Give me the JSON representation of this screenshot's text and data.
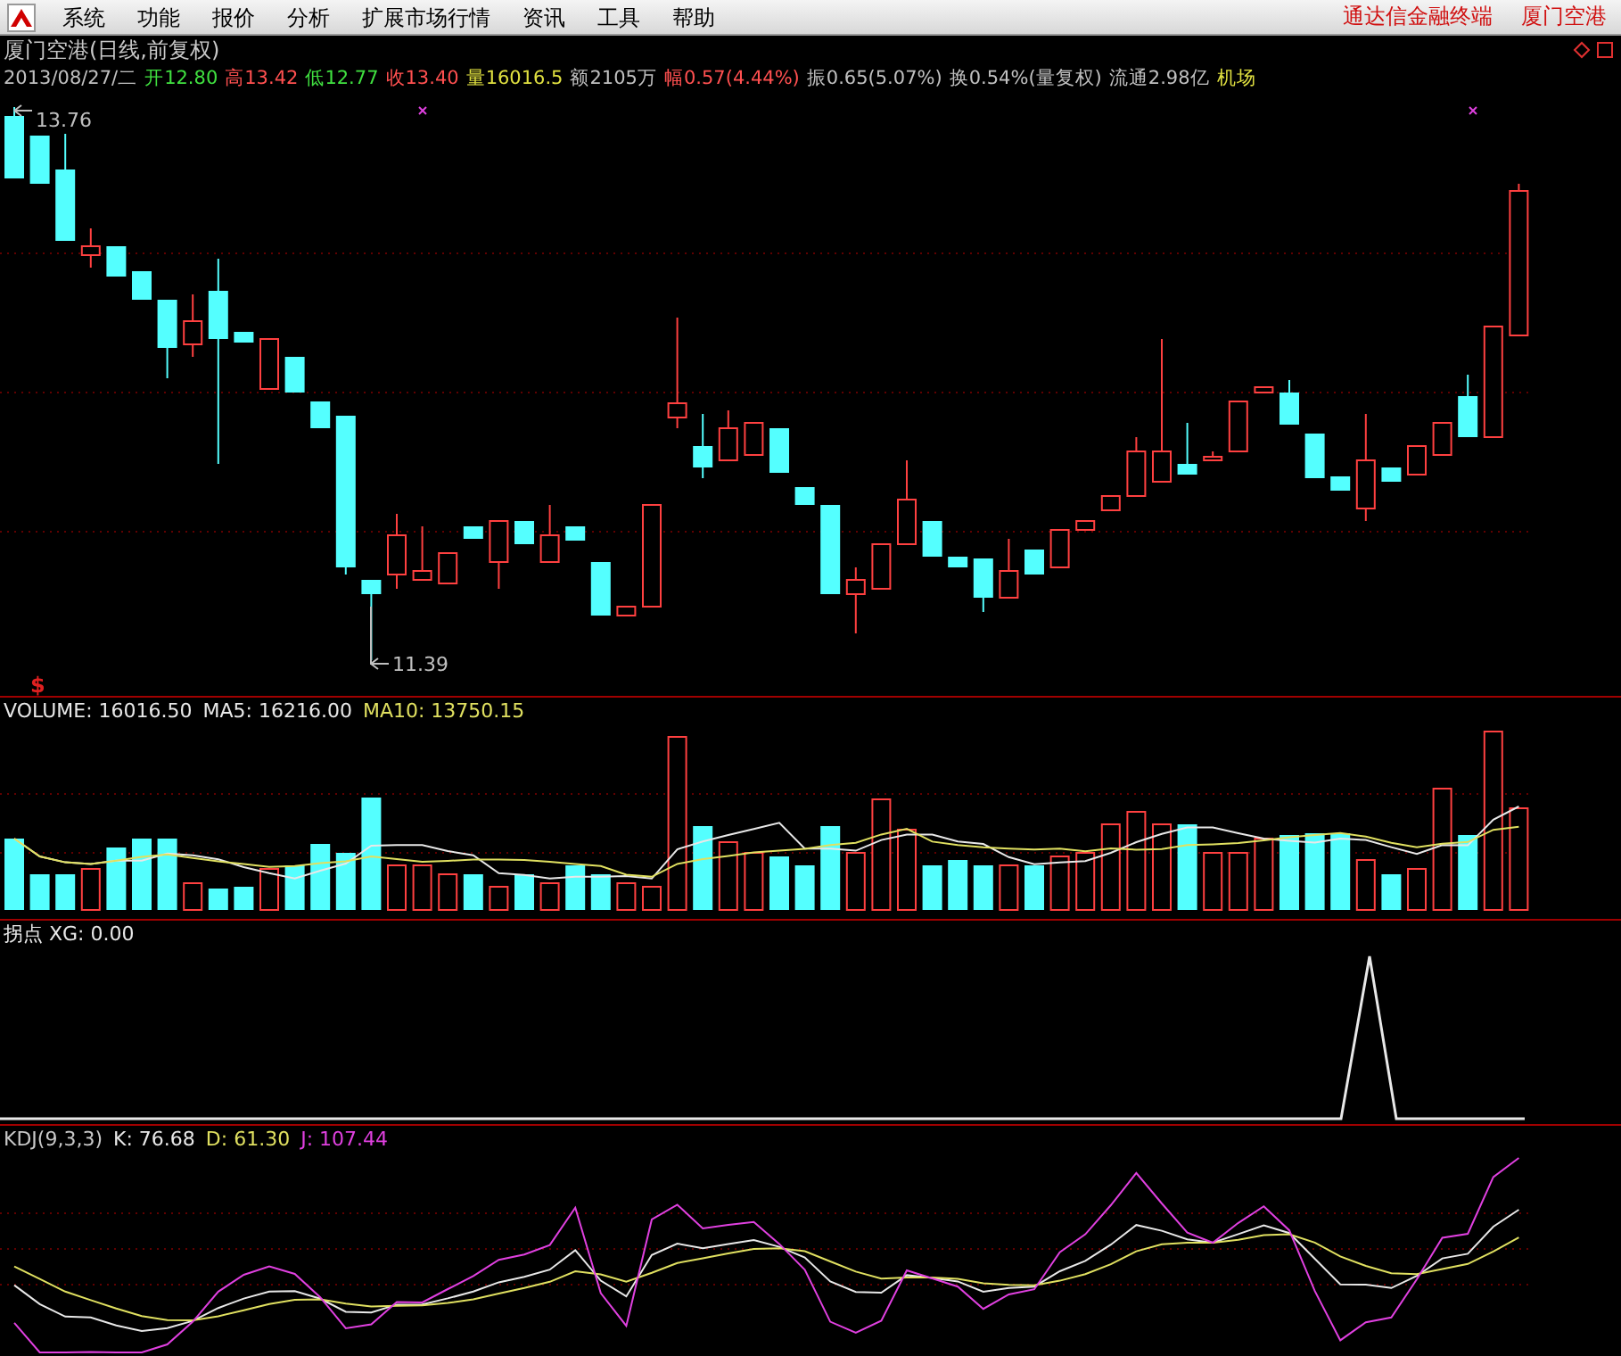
{
  "menu_bar": {
    "items": [
      "系统",
      "功能",
      "报价",
      "分析",
      "扩展市场行情",
      "资讯",
      "工具",
      "帮助"
    ],
    "right_items": [
      "通达信金融终端",
      "厦门空港"
    ]
  },
  "main_chart": {
    "title": "厦门空港(日线,前复权)",
    "quote": [
      {
        "text": "2013/08/27/二",
        "color": "#c0c0c0"
      },
      {
        "text": "开12.80",
        "color": "#40e040"
      },
      {
        "text": "高13.42",
        "color": "#ff5050"
      },
      {
        "text": "低12.77",
        "color": "#40e040"
      },
      {
        "text": "收13.40",
        "color": "#ff5050"
      },
      {
        "text": "量16016.5",
        "color": "#e0e040"
      },
      {
        "text": "额2105万",
        "color": "#c0c0c0"
      },
      {
        "text": "幅0.57(4.44%)",
        "color": "#ff5050"
      },
      {
        "text": "振0.65(5.07%)",
        "color": "#c0c0c0"
      },
      {
        "text": "换0.54%(量复权)",
        "color": "#c0c0c0"
      },
      {
        "text": "流通2.98亿",
        "color": "#c0c0c0"
      },
      {
        "text": "机场",
        "color": "#e0e040"
      }
    ],
    "high_label": "13.76",
    "low_label": "11.39",
    "marker": "$"
  },
  "volume_panel": {
    "legend": [
      {
        "text": "VOLUME: 16016.50",
        "color": "#e8e8e8"
      },
      {
        "text": "MA5: 16216.00",
        "color": "#e8e8e8"
      },
      {
        "text": "MA10: 13750.15",
        "color": "#e0e060"
      }
    ]
  },
  "xg_panel": {
    "legend": [
      {
        "text": "拐点 XG: 0.00",
        "color": "#e8e8e8"
      }
    ]
  },
  "kdj_panel": {
    "legend": [
      {
        "text": "KDJ(9,3,3)",
        "color": "#c8c8c8"
      },
      {
        "text": "K: 76.68",
        "color": "#e8e8e8"
      },
      {
        "text": "D: 61.30",
        "color": "#e0e060"
      },
      {
        "text": "J: 107.44",
        "color": "#e040e0"
      }
    ]
  }
}
